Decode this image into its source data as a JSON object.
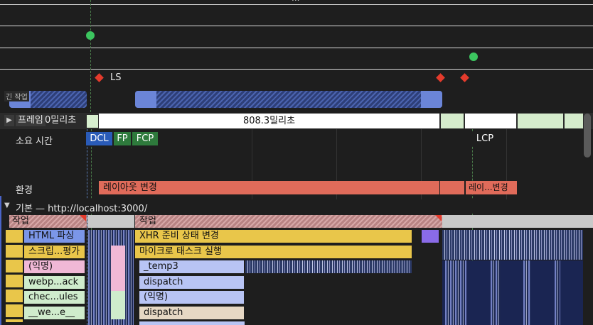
{
  "overview": {
    "top_dots": "...",
    "ls_label": "LS",
    "task_label": "긴 작업"
  },
  "frames": {
    "row_label": "프레임",
    "first_frame": "0밀리초",
    "main_frame": "808.3밀리초"
  },
  "timings": {
    "row_label": "소요 시간",
    "dcl": "DCL",
    "fp": "FP",
    "fcp": "FCP",
    "lcp": "LCP"
  },
  "layout_shifts": {
    "row_label": "환경",
    "shift_1": "레이아웃 변경",
    "shift_2": "레이...변경"
  },
  "main_track": {
    "title": "기본 — http://localhost:3000/",
    "task_1": "작업",
    "task_2": "작업",
    "events_left": [
      "HTML 파싱",
      "스크립...평가",
      "(익명)",
      "webp...ack",
      "chec...ules",
      "__we...e__"
    ],
    "events_right": [
      "XHR 준비 상태 변경",
      "마이크로 태스크 실행",
      "_temp3",
      "dispatch",
      "(익명)",
      "dispatch"
    ]
  },
  "colors": {
    "marker_green": "#3cc55f",
    "marker_red": "#e43b2c",
    "layout_shift": "#e06b5a",
    "dcl": "#2a5bb8",
    "fp_fcp": "#2e7a3c",
    "scripting_yellow": "#e9c64a",
    "lavender": "#b8c4f4"
  }
}
